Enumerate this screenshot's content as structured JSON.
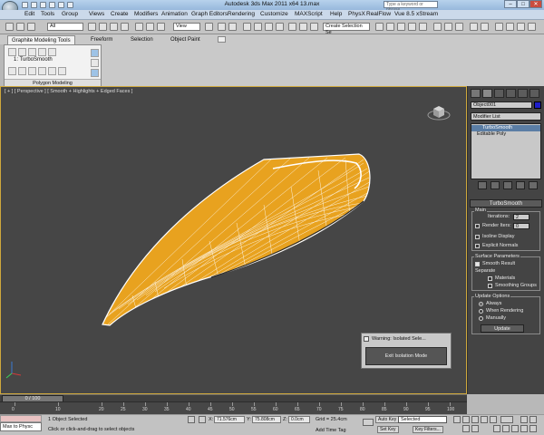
{
  "window": {
    "title": "Autodesk 3ds Max  2011 x64      13.max",
    "search_placeholder": "Type a keyword or phrase"
  },
  "menu": [
    "Edit",
    "Tools",
    "Group",
    "Views",
    "Create",
    "Modifiers",
    "Animation",
    "Graph Editors",
    "Rendering",
    "Customize",
    "MAXScript",
    "Help",
    "PhysX",
    "RealFlow",
    "Vue 8.5 xStream"
  ],
  "toolbar": {
    "filter_value": "All",
    "view_value": "View",
    "selection_set_placeholder": "Create Selection Se"
  },
  "ribbon": {
    "tabs": [
      "Graphite Modeling Tools",
      "Freeform",
      "Selection",
      "Object Paint"
    ],
    "turbosmooth_label": "1: TurboSmooth",
    "polygon_modeling": "Polygon Modeling"
  },
  "viewport": {
    "label": "[ + ] [ Perspective ] [ Smooth + Highlights + Edged Faces ]"
  },
  "command_panel": {
    "object_name": "Object001",
    "object_color": "#1e1ec8",
    "modifier_list": "Modifier List",
    "stack": [
      "TurboSmooth",
      "Editable Poly"
    ],
    "rollout_title": "TurboSmooth",
    "main_group": "Main",
    "iterations_label": "Iterations:",
    "iterations_value": "2",
    "render_iters_label": "Render Iters:",
    "render_iters_value": "0",
    "isoline": "Isoline Display",
    "explicit_normals": "Explicit Normals",
    "surface_group": "Surface Parameters",
    "smooth_result": "Smooth Result",
    "separate": "Separate",
    "materials": "Materials",
    "smoothing_groups": "Smoothing Groups",
    "update_group": "Update Options",
    "always": "Always",
    "when_rendering": "When Rendering",
    "manually": "Manually",
    "update_button": "Update"
  },
  "warning": {
    "title": "Warning: Isolated Sele...",
    "button": "Exit Isolation Mode"
  },
  "timeline": {
    "frame": "0 / 100",
    "ticks": [
      "0",
      "10",
      "20",
      "25",
      "30",
      "35",
      "40",
      "45",
      "50",
      "55",
      "60",
      "65",
      "70",
      "75",
      "80",
      "85",
      "90",
      "95",
      "100"
    ]
  },
  "status": {
    "maxscript": "Max to Physc",
    "selected_count": "1 Object Selected",
    "prompt": "Click or click-and-drag to select objects",
    "x_label": "X:",
    "x_value": "71.576cm",
    "y_label": "Y:",
    "y_value": "75.808cm",
    "z_label": "Z:",
    "z_value": "0.0cm",
    "grid": "Grid = 25.4cm",
    "add_time_tag": "Add Time Tag",
    "auto_key": "Auto Key",
    "set_key": "Set Key",
    "key_filters": "Key Filters...",
    "selected_dropdown": "Selected"
  },
  "colors": {
    "mesh_fill": "#e8a21f",
    "mesh_wire": "#ffffff",
    "viewport_bg": "#464646",
    "active_border": "#cfa83c"
  }
}
